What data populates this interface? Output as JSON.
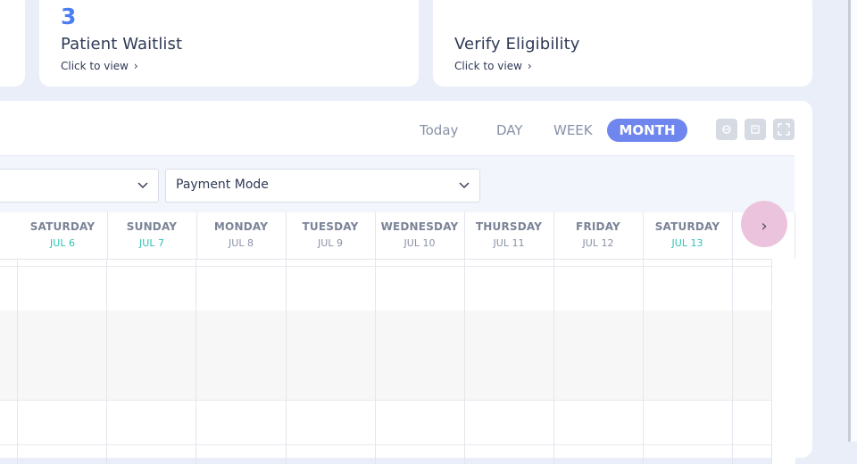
{
  "stats": [
    {
      "count": "3",
      "title": "Patient Waitlist",
      "link": "Click to view"
    },
    {
      "count": "",
      "title": "Verify Eligibility",
      "link": "Click to view"
    }
  ],
  "view_switcher": {
    "today": "Today",
    "day": "DAY",
    "week": "WEEK",
    "month": "MONTH",
    "active": "MONTH"
  },
  "colors": {
    "accent": "#6e86ee",
    "count": "#4a7df0",
    "weekend_date": "#2fc1b4",
    "next_button": "#ecc3dc"
  },
  "filters": {
    "left_select_value": "",
    "payment_mode_placeholder": "Payment Mode"
  },
  "days": [
    {
      "name": "SATURDAY",
      "date": "JUL 6",
      "weekend": true
    },
    {
      "name": "SUNDAY",
      "date": "JUL 7",
      "weekend": true
    },
    {
      "name": "MONDAY",
      "date": "JUL 8",
      "weekend": false
    },
    {
      "name": "TUESDAY",
      "date": "JUL 9",
      "weekend": false
    },
    {
      "name": "WEDNESDAY",
      "date": "JUL 10",
      "weekend": false
    },
    {
      "name": "THURSDAY",
      "date": "JUL 11",
      "weekend": false
    },
    {
      "name": "FRIDAY",
      "date": "JUL 12",
      "weekend": false
    },
    {
      "name": "SATURDAY",
      "date": "JUL 13",
      "weekend": true
    }
  ],
  "icons": {
    "print": "print-icon",
    "save": "save-icon",
    "fullscreen": "fullscreen-icon",
    "next": "chevron-right-icon"
  }
}
